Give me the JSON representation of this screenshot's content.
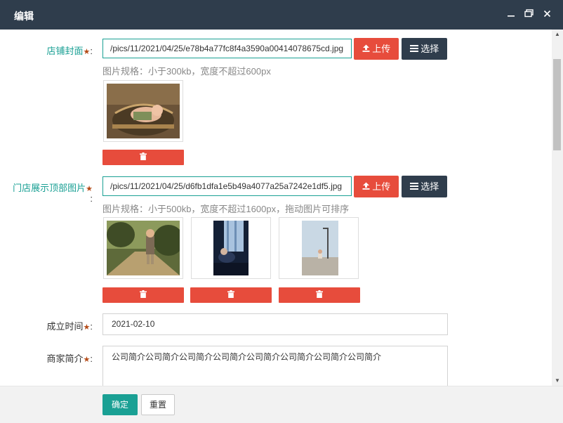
{
  "window": {
    "title": "编辑",
    "minimize_icon": "minimize-icon",
    "maximize_icon": "maximize-icon",
    "close_icon": "close-icon"
  },
  "form": {
    "cover": {
      "label": "店铺封面",
      "required_mark": "★",
      "colon": ":",
      "path_value": "/pics/11/2021/04/25/e78b4a77fc8f4a3590a00414078675cd.jpg",
      "upload_label": "上传",
      "select_label": "选择",
      "hint": "图片规格：小于300kb，宽度不超过600px",
      "images": [
        {
          "alt": "newborn-photo",
          "delete_icon": "trash-icon"
        }
      ]
    },
    "top_images": {
      "label": "门店展示顶部图片",
      "required_mark": "★",
      "colon": ":",
      "path_value": "/pics/11/2021/04/25/d6fb1dfa1e5b49a4077a25a7242e1df5.jpg",
      "upload_label": "上传",
      "select_label": "选择",
      "hint": "图片规格：小于500kb，宽度不超过1600px，拖动图片可排序",
      "images": [
        {
          "alt": "child-in-forest-photo",
          "delete_icon": "trash-icon"
        },
        {
          "alt": "child-by-window-photo",
          "delete_icon": "trash-icon"
        },
        {
          "alt": "child-on-wall-photo",
          "delete_icon": "trash-icon"
        }
      ]
    },
    "founded": {
      "label": "成立时间",
      "required_mark": "★",
      "colon": ":",
      "value": "2021-02-10"
    },
    "intro": {
      "label": "商家简介",
      "required_mark": "★",
      "colon": ":",
      "value": "公司简介公司简介公司简介公司简介公司简介公司简介公司简介公司简介"
    }
  },
  "footer": {
    "confirm_label": "确定",
    "reset_label": "重置"
  },
  "colors": {
    "titlebar": "#2f3d4c",
    "accent": "#1aa094",
    "danger": "#e74c3c",
    "dark": "#2f3d4c"
  }
}
